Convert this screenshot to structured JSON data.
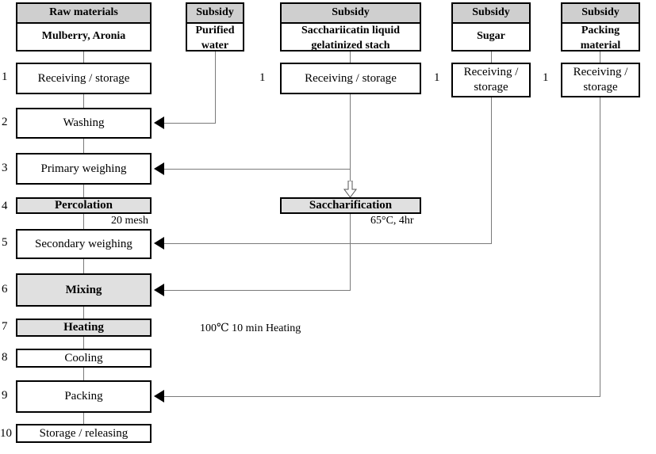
{
  "diagram": {
    "title": "Manufacturing process flow diagram",
    "colors": {
      "header_fill": "#cfcfcf",
      "shaded_fill": "#e0e0e0",
      "line": "#7a7a7a",
      "border": "#000000"
    },
    "materials": [
      {
        "header": "Raw  materials",
        "body": "Mulberry,  Aronia"
      },
      {
        "header": "Subsidy",
        "body": "Purified\nwater"
      },
      {
        "header": "Subsidy",
        "body": "Sacchariicatin  liquid\ngelatinized  stach"
      },
      {
        "header": "Subsidy",
        "body": "Sugar"
      },
      {
        "header": "Subsidy",
        "body": "Packing\nmaterial"
      }
    ],
    "material_labels": {
      "raw_materials_header": "Raw  materials",
      "raw_materials_body": "Mulberry,  Aronia",
      "water_header": "Subsidy",
      "water_body_line1": "Purified",
      "water_body_line2": "water",
      "sacch_header": "Subsidy",
      "sacch_body_line1": "Sacchariicatin  liquid",
      "sacch_body_line2": "gelatinized  stach",
      "sugar_header": "Subsidy",
      "sugar_body": "Sugar",
      "packing_header": "Subsidy",
      "packing_body_line1": "Packing",
      "packing_body_line2": "material"
    },
    "main_steps": [
      {
        "num": "1",
        "label": "Receiving  /  storage",
        "shaded": false
      },
      {
        "num": "2",
        "label": "Washing",
        "shaded": false
      },
      {
        "num": "3",
        "label": "Primary  weighing",
        "shaded": false
      },
      {
        "num": "4",
        "label": "Percolation",
        "shaded": true
      },
      {
        "num": "5",
        "label": "Secondary  weighing",
        "shaded": false
      },
      {
        "num": "6",
        "label": "Mixing",
        "shaded": true
      },
      {
        "num": "7",
        "label": "Heating",
        "shaded": true
      },
      {
        "num": "8",
        "label": "Cooling",
        "shaded": false
      },
      {
        "num": "9",
        "label": "Packing",
        "shaded": false
      },
      {
        "num": "10",
        "label": "Storage  /  releasing",
        "shaded": false
      }
    ],
    "side_steps": [
      {
        "num": "1",
        "label": "Receiving  /  storage",
        "column": "saccharification"
      },
      {
        "num": "1",
        "label_line1": "Receiving  /",
        "label_line2": "storage",
        "column": "sugar"
      },
      {
        "num": "1",
        "label_line1": "Receiving  /",
        "label_line2": "storage",
        "column": "packing"
      }
    ],
    "side_step_labels": {
      "sacch_num": "1",
      "sacch_label": "Receiving  /  storage",
      "sugar_num": "1",
      "sugar_label_line1": "Receiving  /",
      "sugar_label_line2": "storage",
      "packing_num": "1",
      "packing_label_line1": "Receiving  /",
      "packing_label_line2": "storage"
    },
    "process_box": {
      "label": "Saccharification",
      "condition": "65°C,  4hr"
    },
    "annotations": [
      {
        "text": "20  mesh",
        "name": "percolation-mesh-note"
      },
      {
        "text": "65°C,  4hr",
        "name": "saccharification-condition-note"
      },
      {
        "text": "100℃  10  min  Heating",
        "name": "heating-condition-note"
      }
    ],
    "annotation_labels": {
      "mesh": "20  mesh",
      "saccharification": "65°C,  4hr",
      "heating": "100℃  10  min  Heating"
    },
    "step_numbers": {
      "s1": "1",
      "s2": "2",
      "s3": "3",
      "s4": "4",
      "s5": "5",
      "s6": "6",
      "s7": "7",
      "s8": "8",
      "s9": "9",
      "s10": "10"
    },
    "step_labels": {
      "receiving": "Receiving  /  storage",
      "washing": "Washing",
      "primary_weighing": "Primary  weighing",
      "percolation": "Percolation",
      "secondary_weighing": "Secondary  weighing",
      "mixing": "Mixing",
      "heating": "Heating",
      "cooling": "Cooling",
      "packing": "Packing",
      "storage_releasing": "Storage  /  releasing"
    }
  }
}
